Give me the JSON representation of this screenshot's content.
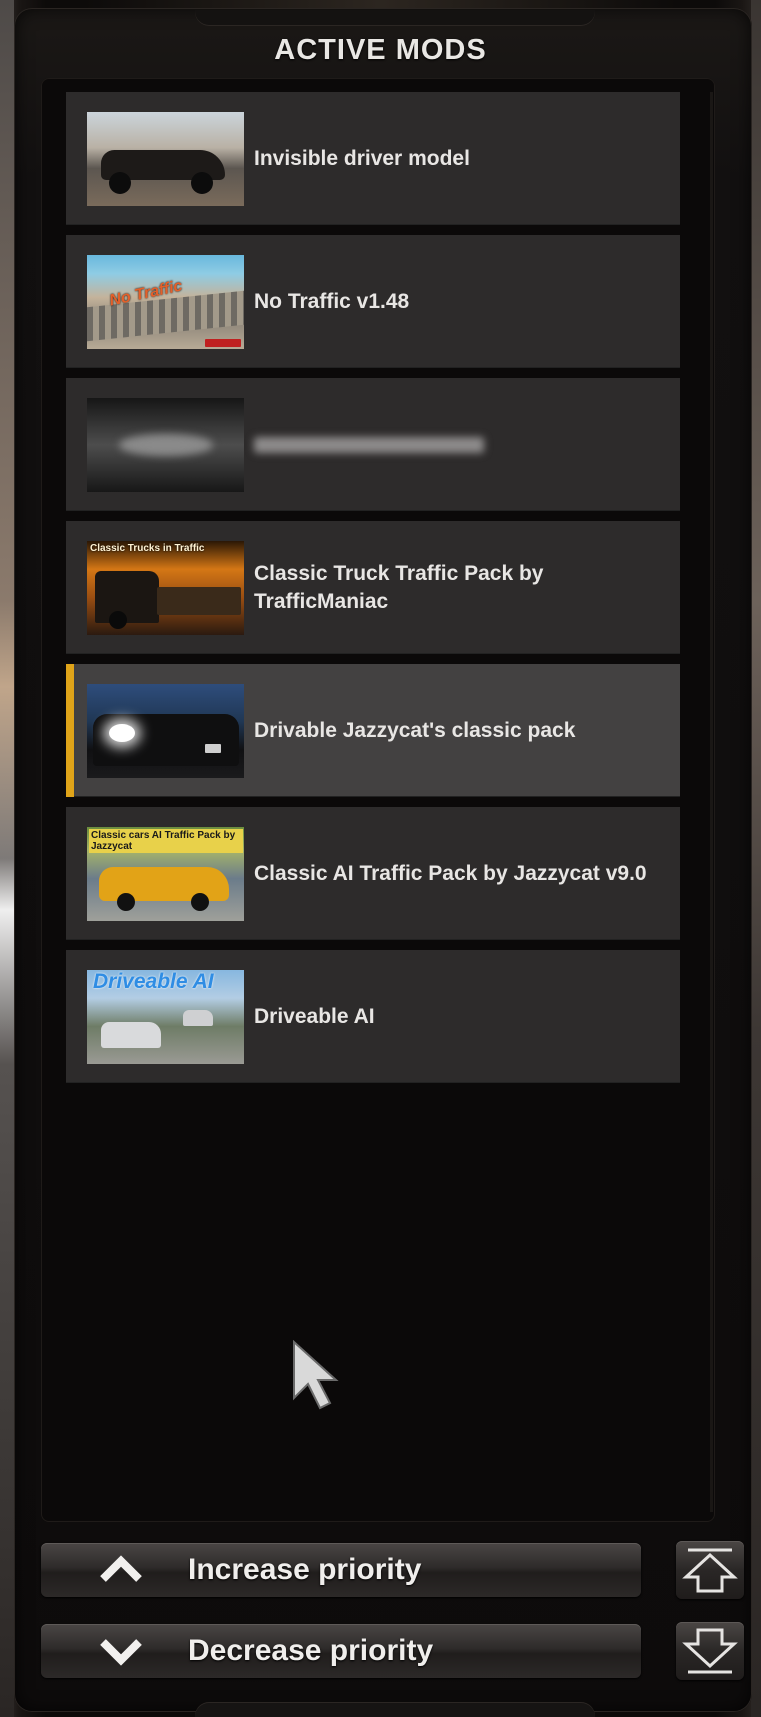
{
  "panel": {
    "title": "ACTIVE MODS"
  },
  "mods": [
    {
      "name": "Invisible driver model",
      "selected": false,
      "blurred": false,
      "thumbnail_text": ""
    },
    {
      "name": "No Traffic v1.48",
      "selected": false,
      "blurred": false,
      "thumbnail_text": "No Traffic"
    },
    {
      "name": "",
      "selected": false,
      "blurred": true,
      "thumbnail_text": ""
    },
    {
      "name": "Classic Truck Traffic Pack by TrafficManiac",
      "selected": false,
      "blurred": false,
      "thumbnail_text": "Classic Trucks in Traffic"
    },
    {
      "name": "Drivable Jazzycat's classic pack",
      "selected": true,
      "blurred": false,
      "thumbnail_text": ""
    },
    {
      "name": "Classic AI Traffic Pack by Jazzycat v9.0",
      "selected": false,
      "blurred": false,
      "thumbnail_text": "Classic cars AI Traffic Pack by Jazzycat"
    },
    {
      "name": "Driveable AI",
      "selected": false,
      "blurred": false,
      "thumbnail_text": "Driveable AI"
    }
  ],
  "buttons": {
    "increase_label": "Increase priority",
    "decrease_label": "Decrease priority"
  },
  "icons": {
    "increase": "chevron-up-icon",
    "decrease": "chevron-down-icon",
    "move_top": "move-to-top-icon",
    "move_bottom": "move-to-bottom-icon",
    "cursor": "mouse-cursor-icon"
  },
  "colors": {
    "selection_accent": "#e0a419",
    "item_background": "#2d2b2b",
    "item_selected_background": "#434141",
    "text": "#e8e6e4"
  }
}
